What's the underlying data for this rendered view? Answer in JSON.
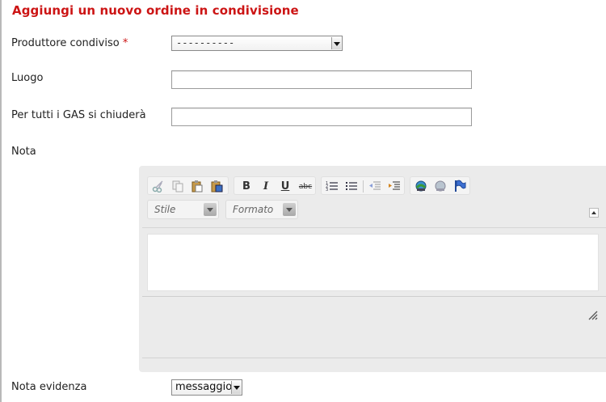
{
  "form": {
    "title": "Aggiungi un nuovo ordine in condivisione",
    "producer": {
      "label": "Produttore condiviso",
      "required_mark": "*",
      "selected": "----------"
    },
    "place": {
      "label": "Luogo",
      "value": ""
    },
    "close_date": {
      "label": "Per tutti i GAS si chiuderà",
      "value": ""
    },
    "note": {
      "label": "Nota",
      "toolbar": {
        "clipboard": [
          "cut-icon",
          "copy-icon",
          "paste-icon",
          "paste-from-word-icon"
        ],
        "formatting": {
          "bold": "B",
          "italic": "I",
          "underline": "U",
          "strike": "abc"
        },
        "lists": [
          "numbered-list-icon",
          "bulleted-list-icon",
          "outdent-icon",
          "indent-icon"
        ],
        "links": [
          "link-icon",
          "unlink-icon",
          "anchor-icon"
        ],
        "style_combo": "Stile",
        "format_combo": "Formato"
      },
      "content": ""
    },
    "highlight": {
      "label": "Nota evidenza",
      "selected": "messaggio"
    }
  },
  "colors": {
    "title": "#cc1414",
    "editor_bg": "#ebebeb",
    "required": "#cc1414"
  }
}
